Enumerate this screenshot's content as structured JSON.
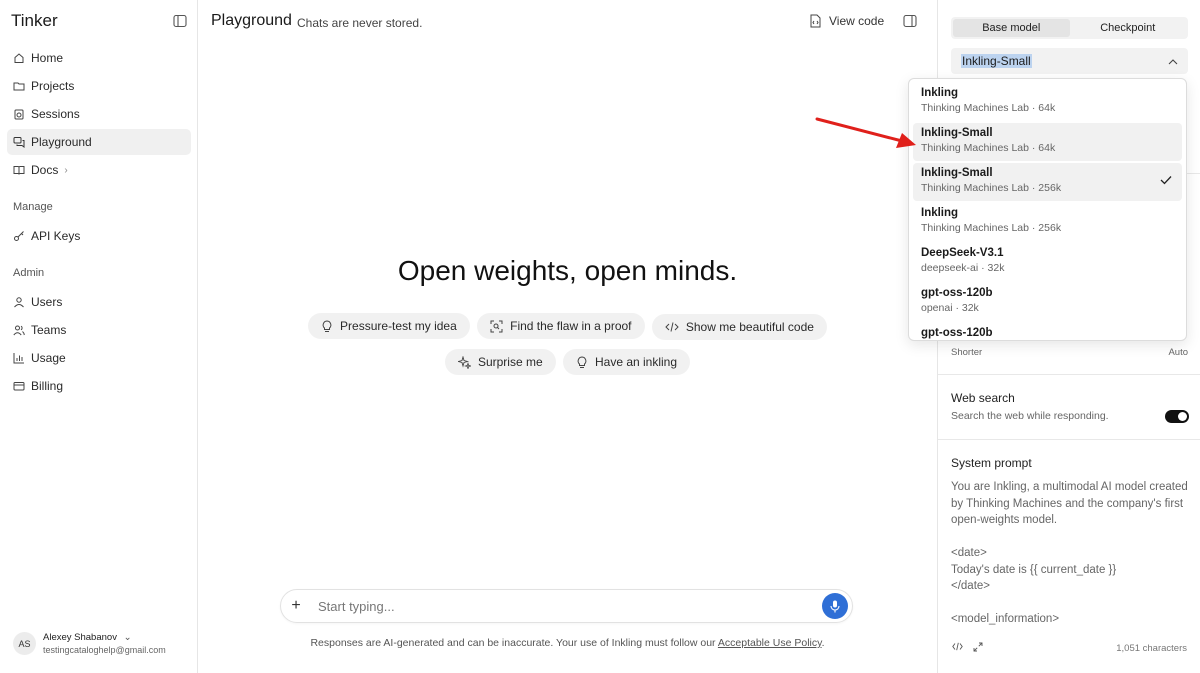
{
  "sidebar": {
    "brand": "Tinker",
    "nav": [
      {
        "label": "Home",
        "icon": "home-icon"
      },
      {
        "label": "Projects",
        "icon": "folder-icon"
      },
      {
        "label": "Sessions",
        "icon": "sessions-icon"
      },
      {
        "label": "Playground",
        "icon": "chat-icon",
        "active": true
      },
      {
        "label": "Docs",
        "icon": "book-icon"
      }
    ],
    "manage_label": "Manage",
    "manage": [
      {
        "label": "API Keys",
        "icon": "key-icon"
      }
    ],
    "admin_label": "Admin",
    "admin": [
      {
        "label": "Users",
        "icon": "user-icon"
      },
      {
        "label": "Teams",
        "icon": "team-icon"
      },
      {
        "label": "Usage",
        "icon": "chart-icon"
      },
      {
        "label": "Billing",
        "icon": "card-icon"
      }
    ],
    "user": {
      "initials": "AS",
      "name": "Alexey Shabanov",
      "email": "testingcataloghelp@gmail.com"
    }
  },
  "main": {
    "title": "Playground",
    "subtitle": "Chats are never stored.",
    "view_code": "View code",
    "hero": "Open weights, open minds.",
    "suggestions_row1": [
      "Pressure-test my idea",
      "Find the flaw in a proof",
      "Show me beautiful code"
    ],
    "suggestions_row2": [
      "Surprise me",
      "Have an inkling"
    ],
    "composer_placeholder": "Start typing...",
    "disclaimer_text": "Responses are AI-generated and can be inaccurate. Your use of Inkling must follow our ",
    "disclaimer_link": "Acceptable Use Policy",
    "disclaimer_end": "."
  },
  "right_panel": {
    "tabs": [
      "Base model",
      "Checkpoint"
    ],
    "active_tab": "Base model",
    "selected_model": "Inkling-Small",
    "length_min_label": "Shorter",
    "length_max_label": "Auto",
    "web_search_title": "Web search",
    "web_search_desc": "Search the web while responding.",
    "web_search_enabled": true,
    "system_prompt_title": "System prompt",
    "system_prompt": "You are Inkling, a multimodal AI model created by Thinking Machines and the company's first open-weights model.\n\n<date>\nToday's date is {{ current_date }}\n</date>\n\n<model_information>",
    "char_count": "1,051 characters"
  },
  "dropdown": {
    "options": [
      {
        "name": "Inkling",
        "meta": "Thinking Machines Lab · 64k",
        "state": "none"
      },
      {
        "name": "Inkling-Small",
        "meta": "Thinking Machines Lab · 64k",
        "state": "hover"
      },
      {
        "name": "Inkling-Small",
        "meta": "Thinking Machines Lab · 256k",
        "state": "selected"
      },
      {
        "name": "Inkling",
        "meta": "Thinking Machines Lab · 256k",
        "state": "none"
      },
      {
        "name": "DeepSeek-V3.1",
        "meta": "deepseek-ai · 32k",
        "state": "none"
      },
      {
        "name": "gpt-oss-120b",
        "meta": "openai · 32k",
        "state": "none"
      },
      {
        "name": "gpt-oss-120b",
        "meta": "",
        "state": "none"
      }
    ]
  },
  "colors": {
    "accent": "#2f6fd6",
    "annotation_arrow": "#e0201b",
    "selection": "#bcd3ef"
  }
}
